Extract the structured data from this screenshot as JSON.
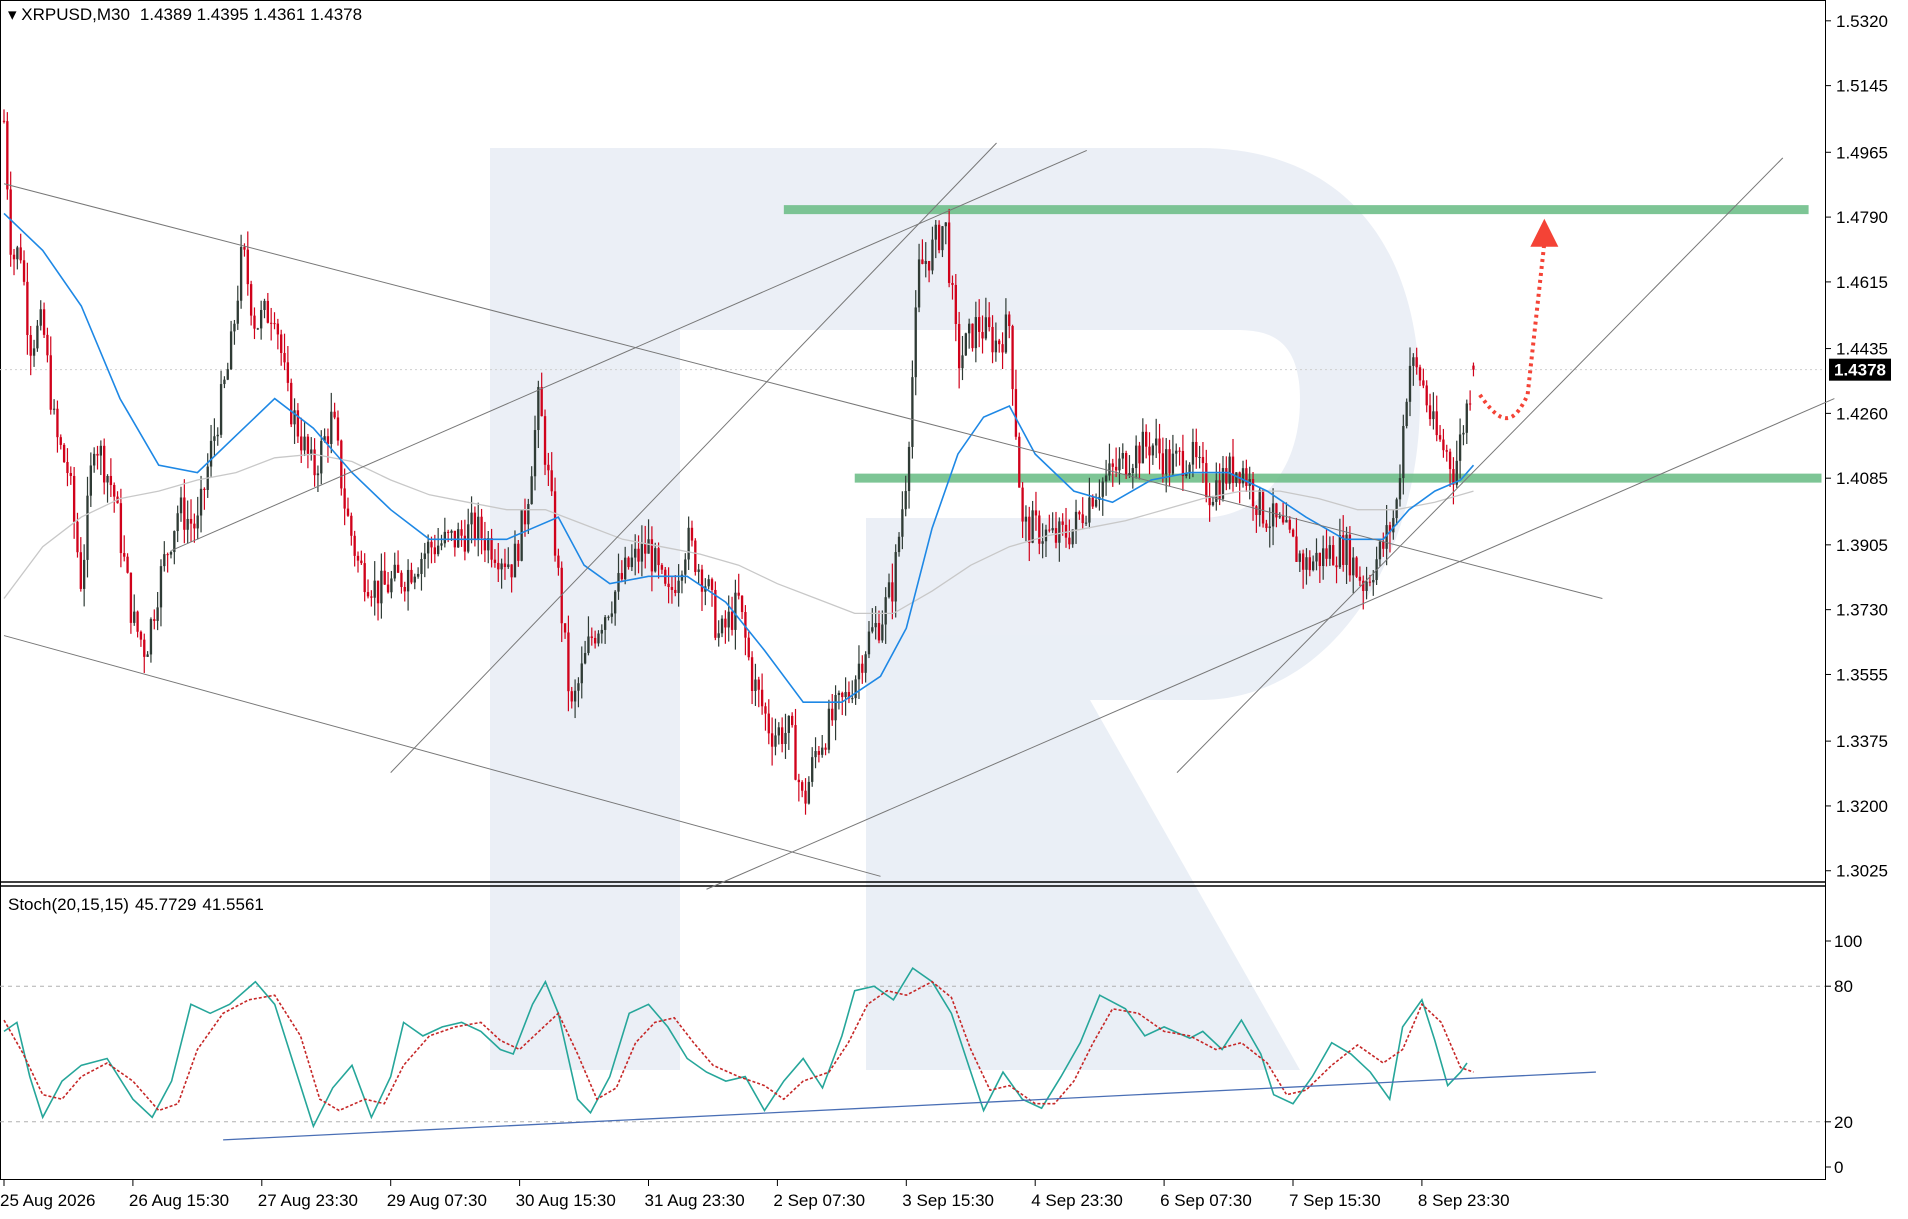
{
  "header": {
    "symbol_label": "XRPUSD,M30",
    "ohlc_text": "1.4389 1.4395 1.4361 1.4378"
  },
  "colors": {
    "bull_candle": "#2f3b35",
    "bear_candle": "#d0021b",
    "ma_fast": "#1e88e5",
    "ma_slow": "#c8c8c8",
    "zone": "#6fbf8a",
    "stoch_main": "#26a69a",
    "stoch_signal": "#c62828",
    "stoch_trend": "#4a6fb5",
    "forecast_arrow": "#f44336",
    "price_tag_bg": "#000000"
  },
  "chart_data": {
    "type": "candlestick",
    "symbol": "XRPUSD",
    "timeframe": "M30",
    "ohlc_last": {
      "open": 1.4389,
      "high": 1.4395,
      "low": 1.4361,
      "close": 1.4378
    },
    "current_price": 1.4378,
    "current_price_label": "1.4378",
    "y_ticks": [
      "1.5320",
      "1.5145",
      "1.4965",
      "1.4790",
      "1.4615",
      "1.4435",
      "1.4260",
      "1.4085",
      "1.3905",
      "1.3730",
      "1.3555",
      "1.3375",
      "1.3200",
      "1.3025"
    ],
    "y_tick_values": [
      1.532,
      1.5145,
      1.4965,
      1.479,
      1.4615,
      1.4435,
      1.426,
      1.4085,
      1.3905,
      1.373,
      1.3555,
      1.3375,
      1.32,
      1.3025
    ],
    "ylim": [
      1.3,
      1.536
    ],
    "x_ticks": [
      "25 Aug 2026",
      "26 Aug 15:30",
      "27 Aug 23:30",
      "29 Aug 07:30",
      "30 Aug 15:30",
      "31 Aug 23:30",
      "2 Sep 07:30",
      "3 Sep 15:30",
      "4 Sep 23:30",
      "6 Sep 07:30",
      "7 Sep 15:30",
      "8 Sep 23:30"
    ],
    "x_tick_index": [
      0,
      1,
      2,
      3,
      4,
      5,
      6,
      7,
      8,
      9,
      10,
      11
    ],
    "price_path": [
      [
        0.0,
        1.505
      ],
      [
        0.06,
        1.468
      ],
      [
        0.13,
        1.47
      ],
      [
        0.2,
        1.445
      ],
      [
        0.3,
        1.45
      ],
      [
        0.4,
        1.42
      ],
      [
        0.5,
        1.41
      ],
      [
        0.6,
        1.38
      ],
      [
        0.7,
        1.42
      ],
      [
        0.85,
        1.405
      ],
      [
        1.0,
        1.37
      ],
      [
        1.1,
        1.362
      ],
      [
        1.2,
        1.38
      ],
      [
        1.35,
        1.4
      ],
      [
        1.5,
        1.395
      ],
      [
        1.6,
        1.415
      ],
      [
        1.75,
        1.44
      ],
      [
        1.85,
        1.47
      ],
      [
        1.95,
        1.45
      ],
      [
        2.1,
        1.455
      ],
      [
        2.2,
        1.43
      ],
      [
        2.4,
        1.41
      ],
      [
        2.55,
        1.425
      ],
      [
        2.65,
        1.4
      ],
      [
        2.75,
        1.385
      ],
      [
        2.9,
        1.378
      ],
      [
        3.1,
        1.382
      ],
      [
        3.3,
        1.39
      ],
      [
        3.5,
        1.392
      ],
      [
        3.65,
        1.395
      ],
      [
        3.8,
        1.39
      ],
      [
        3.95,
        1.385
      ],
      [
        4.05,
        1.4
      ],
      [
        4.15,
        1.43
      ],
      [
        4.25,
        1.4
      ],
      [
        4.4,
        1.345
      ],
      [
        4.55,
        1.365
      ],
      [
        4.7,
        1.375
      ],
      [
        4.85,
        1.385
      ],
      [
        5.0,
        1.39
      ],
      [
        5.15,
        1.375
      ],
      [
        5.3,
        1.392
      ],
      [
        5.45,
        1.38
      ],
      [
        5.55,
        1.365
      ],
      [
        5.7,
        1.375
      ],
      [
        5.8,
        1.355
      ],
      [
        5.95,
        1.34
      ],
      [
        6.1,
        1.34
      ],
      [
        6.2,
        1.32
      ],
      [
        6.3,
        1.335
      ],
      [
        6.45,
        1.345
      ],
      [
        6.55,
        1.35
      ],
      [
        6.7,
        1.365
      ],
      [
        6.8,
        1.37
      ],
      [
        6.9,
        1.38
      ],
      [
        7.0,
        1.41
      ],
      [
        7.1,
        1.465
      ],
      [
        7.2,
        1.47
      ],
      [
        7.3,
        1.478
      ],
      [
        7.4,
        1.44
      ],
      [
        7.55,
        1.45
      ],
      [
        7.7,
        1.445
      ],
      [
        7.8,
        1.45
      ],
      [
        7.9,
        1.395
      ],
      [
        8.0,
        1.395
      ],
      [
        8.15,
        1.392
      ],
      [
        8.3,
        1.395
      ],
      [
        8.45,
        1.405
      ],
      [
        8.6,
        1.41
      ],
      [
        8.75,
        1.415
      ],
      [
        8.9,
        1.418
      ],
      [
        9.05,
        1.412
      ],
      [
        9.2,
        1.415
      ],
      [
        9.35,
        1.405
      ],
      [
        9.5,
        1.41
      ],
      [
        9.6,
        1.412
      ],
      [
        9.75,
        1.4
      ],
      [
        9.9,
        1.395
      ],
      [
        10.0,
        1.39
      ],
      [
        10.1,
        1.385
      ],
      [
        10.25,
        1.388
      ],
      [
        10.4,
        1.39
      ],
      [
        10.55,
        1.38
      ],
      [
        10.7,
        1.39
      ],
      [
        10.8,
        1.4
      ],
      [
        10.9,
        1.44
      ],
      [
        11.0,
        1.435
      ],
      [
        11.1,
        1.42
      ],
      [
        11.2,
        1.415
      ],
      [
        11.25,
        1.41
      ],
      [
        11.35,
        1.428
      ],
      [
        11.4,
        1.4378
      ]
    ],
    "ma_fast_path": [
      [
        0.0,
        1.48
      ],
      [
        0.3,
        1.47
      ],
      [
        0.6,
        1.455
      ],
      [
        0.9,
        1.43
      ],
      [
        1.2,
        1.412
      ],
      [
        1.5,
        1.41
      ],
      [
        1.8,
        1.42
      ],
      [
        2.1,
        1.43
      ],
      [
        2.4,
        1.422
      ],
      [
        2.7,
        1.41
      ],
      [
        3.0,
        1.4
      ],
      [
        3.3,
        1.392
      ],
      [
        3.6,
        1.392
      ],
      [
        3.9,
        1.392
      ],
      [
        4.1,
        1.395
      ],
      [
        4.3,
        1.398
      ],
      [
        4.5,
        1.385
      ],
      [
        4.7,
        1.38
      ],
      [
        5.0,
        1.382
      ],
      [
        5.3,
        1.382
      ],
      [
        5.6,
        1.375
      ],
      [
        5.9,
        1.362
      ],
      [
        6.2,
        1.348
      ],
      [
        6.5,
        1.348
      ],
      [
        6.8,
        1.355
      ],
      [
        7.0,
        1.368
      ],
      [
        7.2,
        1.395
      ],
      [
        7.4,
        1.415
      ],
      [
        7.6,
        1.425
      ],
      [
        7.8,
        1.428
      ],
      [
        8.0,
        1.415
      ],
      [
        8.3,
        1.405
      ],
      [
        8.6,
        1.402
      ],
      [
        8.9,
        1.408
      ],
      [
        9.2,
        1.41
      ],
      [
        9.5,
        1.41
      ],
      [
        9.8,
        1.405
      ],
      [
        10.1,
        1.398
      ],
      [
        10.4,
        1.392
      ],
      [
        10.7,
        1.392
      ],
      [
        10.9,
        1.4
      ],
      [
        11.1,
        1.405
      ],
      [
        11.3,
        1.408
      ],
      [
        11.4,
        1.412
      ]
    ],
    "ma_slow_path": [
      [
        0.0,
        1.376
      ],
      [
        0.3,
        1.39
      ],
      [
        0.6,
        1.398
      ],
      [
        0.9,
        1.403
      ],
      [
        1.2,
        1.405
      ],
      [
        1.5,
        1.408
      ],
      [
        1.8,
        1.41
      ],
      [
        2.1,
        1.414
      ],
      [
        2.4,
        1.415
      ],
      [
        2.7,
        1.413
      ],
      [
        3.0,
        1.408
      ],
      [
        3.3,
        1.404
      ],
      [
        3.6,
        1.402
      ],
      [
        3.9,
        1.4
      ],
      [
        4.2,
        1.4
      ],
      [
        4.5,
        1.396
      ],
      [
        4.8,
        1.392
      ],
      [
        5.1,
        1.39
      ],
      [
        5.4,
        1.388
      ],
      [
        5.7,
        1.385
      ],
      [
        6.0,
        1.38
      ],
      [
        6.3,
        1.376
      ],
      [
        6.6,
        1.372
      ],
      [
        6.9,
        1.372
      ],
      [
        7.2,
        1.378
      ],
      [
        7.5,
        1.385
      ],
      [
        7.8,
        1.39
      ],
      [
        8.1,
        1.393
      ],
      [
        8.4,
        1.395
      ],
      [
        8.7,
        1.397
      ],
      [
        9.0,
        1.4
      ],
      [
        9.3,
        1.403
      ],
      [
        9.6,
        1.405
      ],
      [
        9.9,
        1.405
      ],
      [
        10.2,
        1.403
      ],
      [
        10.5,
        1.4
      ],
      [
        10.8,
        1.4
      ],
      [
        11.1,
        1.402
      ],
      [
        11.4,
        1.405
      ]
    ],
    "zones": [
      {
        "price": 1.481,
        "x_start": 6.05,
        "x_end": 14.0
      },
      {
        "price": 1.4085,
        "x_start": 6.6,
        "x_end": 14.1
      }
    ],
    "trend_lines": [
      {
        "from": [
          0.0,
          1.488
        ],
        "to": [
          12.4,
          1.376
        ]
      },
      {
        "from": [
          0.0,
          1.366
        ],
        "to": [
          6.8,
          1.301
        ]
      },
      {
        "from": [
          1.3,
          1.389
        ],
        "to": [
          8.4,
          1.497
        ]
      },
      {
        "from": [
          3.0,
          1.329
        ],
        "to": [
          7.7,
          1.499
        ]
      },
      {
        "from": [
          5.45,
          1.2975
        ],
        "to": [
          14.2,
          1.43
        ]
      },
      {
        "from": [
          9.1,
          1.329
        ],
        "to": [
          13.8,
          1.495
        ]
      }
    ],
    "forecast_path": [
      [
        11.45,
        1.431
      ],
      [
        11.7,
        1.426
      ],
      [
        11.82,
        1.431
      ],
      [
        11.95,
        1.478
      ]
    ],
    "stoch": {
      "label": "Stoch(20,15,15)",
      "main_value": "45.7729",
      "signal_value": "41.5561",
      "levels": [
        80,
        20
      ],
      "y_ticks": [
        "100",
        "80",
        "20",
        "0"
      ],
      "y_tick_values": [
        100,
        80,
        20,
        0
      ],
      "main_path": [
        [
          0.0,
          60
        ],
        [
          0.1,
          64
        ],
        [
          0.2,
          40
        ],
        [
          0.3,
          22
        ],
        [
          0.45,
          38
        ],
        [
          0.6,
          45
        ],
        [
          0.8,
          48
        ],
        [
          1.0,
          30
        ],
        [
          1.15,
          22
        ],
        [
          1.3,
          38
        ],
        [
          1.45,
          72
        ],
        [
          1.6,
          68
        ],
        [
          1.75,
          72
        ],
        [
          1.95,
          82
        ],
        [
          2.1,
          72
        ],
        [
          2.25,
          45
        ],
        [
          2.4,
          18
        ],
        [
          2.55,
          35
        ],
        [
          2.7,
          45
        ],
        [
          2.85,
          22
        ],
        [
          3.0,
          40
        ],
        [
          3.1,
          64
        ],
        [
          3.25,
          58
        ],
        [
          3.4,
          62
        ],
        [
          3.55,
          64
        ],
        [
          3.7,
          60
        ],
        [
          3.85,
          52
        ],
        [
          3.95,
          50
        ],
        [
          4.1,
          72
        ],
        [
          4.2,
          82
        ],
        [
          4.3,
          68
        ],
        [
          4.45,
          30
        ],
        [
          4.55,
          24
        ],
        [
          4.7,
          40
        ],
        [
          4.85,
          68
        ],
        [
          5.0,
          72
        ],
        [
          5.15,
          62
        ],
        [
          5.3,
          48
        ],
        [
          5.45,
          42
        ],
        [
          5.6,
          38
        ],
        [
          5.75,
          40
        ],
        [
          5.9,
          25
        ],
        [
          6.05,
          38
        ],
        [
          6.2,
          48
        ],
        [
          6.35,
          35
        ],
        [
          6.5,
          58
        ],
        [
          6.6,
          78
        ],
        [
          6.75,
          80
        ],
        [
          6.9,
          74
        ],
        [
          7.05,
          88
        ],
        [
          7.2,
          82
        ],
        [
          7.35,
          68
        ],
        [
          7.5,
          42
        ],
        [
          7.6,
          25
        ],
        [
          7.75,
          42
        ],
        [
          7.9,
          30
        ],
        [
          8.05,
          26
        ],
        [
          8.2,
          40
        ],
        [
          8.35,
          55
        ],
        [
          8.5,
          76
        ],
        [
          8.7,
          70
        ],
        [
          8.85,
          58
        ],
        [
          9.0,
          62
        ],
        [
          9.2,
          57
        ],
        [
          9.3,
          60
        ],
        [
          9.45,
          52
        ],
        [
          9.6,
          65
        ],
        [
          9.75,
          50
        ],
        [
          9.85,
          32
        ],
        [
          10.0,
          28
        ],
        [
          10.15,
          40
        ],
        [
          10.3,
          55
        ],
        [
          10.45,
          50
        ],
        [
          10.6,
          42
        ],
        [
          10.75,
          30
        ],
        [
          10.85,
          62
        ],
        [
          11.0,
          74
        ],
        [
          11.1,
          56
        ],
        [
          11.2,
          36
        ],
        [
          11.3,
          42
        ],
        [
          11.35,
          46
        ]
      ],
      "signal_path": [
        [
          0.0,
          65
        ],
        [
          0.15,
          50
        ],
        [
          0.3,
          32
        ],
        [
          0.45,
          30
        ],
        [
          0.6,
          40
        ],
        [
          0.8,
          46
        ],
        [
          1.0,
          38
        ],
        [
          1.2,
          25
        ],
        [
          1.35,
          28
        ],
        [
          1.5,
          52
        ],
        [
          1.7,
          68
        ],
        [
          1.9,
          74
        ],
        [
          2.1,
          76
        ],
        [
          2.3,
          58
        ],
        [
          2.45,
          30
        ],
        [
          2.6,
          25
        ],
        [
          2.8,
          30
        ],
        [
          2.95,
          28
        ],
        [
          3.1,
          45
        ],
        [
          3.3,
          58
        ],
        [
          3.5,
          62
        ],
        [
          3.7,
          64
        ],
        [
          3.85,
          56
        ],
        [
          4.0,
          52
        ],
        [
          4.15,
          60
        ],
        [
          4.3,
          68
        ],
        [
          4.45,
          50
        ],
        [
          4.6,
          30
        ],
        [
          4.75,
          35
        ],
        [
          4.9,
          55
        ],
        [
          5.05,
          64
        ],
        [
          5.2,
          66
        ],
        [
          5.35,
          55
        ],
        [
          5.5,
          45
        ],
        [
          5.7,
          40
        ],
        [
          5.9,
          36
        ],
        [
          6.05,
          30
        ],
        [
          6.2,
          38
        ],
        [
          6.4,
          42
        ],
        [
          6.55,
          55
        ],
        [
          6.7,
          72
        ],
        [
          6.85,
          78
        ],
        [
          7.0,
          76
        ],
        [
          7.2,
          82
        ],
        [
          7.35,
          75
        ],
        [
          7.5,
          52
        ],
        [
          7.65,
          34
        ],
        [
          7.8,
          36
        ],
        [
          8.0,
          28
        ],
        [
          8.15,
          28
        ],
        [
          8.3,
          38
        ],
        [
          8.45,
          55
        ],
        [
          8.6,
          70
        ],
        [
          8.8,
          68
        ],
        [
          9.0,
          60
        ],
        [
          9.2,
          58
        ],
        [
          9.4,
          52
        ],
        [
          9.6,
          55
        ],
        [
          9.8,
          46
        ],
        [
          9.95,
          32
        ],
        [
          10.1,
          34
        ],
        [
          10.3,
          45
        ],
        [
          10.5,
          54
        ],
        [
          10.7,
          46
        ],
        [
          10.85,
          52
        ],
        [
          11.0,
          72
        ],
        [
          11.15,
          64
        ],
        [
          11.3,
          44
        ],
        [
          11.4,
          42
        ]
      ],
      "trend_line": {
        "from": [
          1.7,
          12
        ],
        "to": [
          12.35,
          42
        ]
      }
    }
  }
}
